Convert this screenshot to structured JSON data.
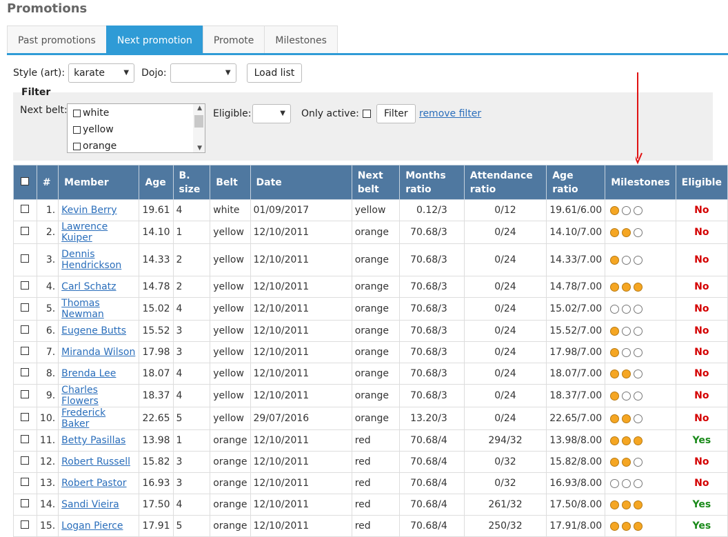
{
  "page": {
    "title": "Promotions"
  },
  "tabs": [
    {
      "label": "Past promotions",
      "active": false
    },
    {
      "label": "Next promotion",
      "active": true
    },
    {
      "label": "Promote",
      "active": false
    },
    {
      "label": "Milestones",
      "active": false
    }
  ],
  "toolbar": {
    "style_label": "Style (art):",
    "style_value": "karate",
    "dojo_label": "Dojo:",
    "dojo_value": "",
    "load_button": "Load list"
  },
  "filter": {
    "title": "Filter",
    "next_belt_label": "Next belt:",
    "belts": [
      "white",
      "yellow",
      "orange"
    ],
    "eligible_label": "Eligible:",
    "eligible_value": "",
    "only_active_label": "Only active:",
    "filter_button": "Filter",
    "remove_filter": "remove filter"
  },
  "table": {
    "headers": [
      "#",
      "Member",
      "Age",
      "B. size",
      "Belt",
      "Date",
      "Next belt",
      "Months ratio",
      "Attendance ratio",
      "Age ratio",
      "Milestones",
      "Eligible"
    ],
    "header_lines": {
      "bsize": [
        "B.",
        "size"
      ],
      "nextbelt": [
        "Next",
        "belt"
      ],
      "months": [
        "Months",
        "ratio"
      ],
      "attendance": [
        "Attendance",
        "ratio"
      ],
      "ageratio": [
        "Age",
        "ratio"
      ]
    },
    "rows": [
      {
        "n": "1.",
        "name": "Kevin Berry",
        "age": "19.61",
        "bsize": "4",
        "belt": "white",
        "date": "01/09/2017",
        "next": "yellow",
        "months": "0.12/3",
        "att": "0/12",
        "ageratio": "19.61/6.00",
        "milestones": [
          1,
          0,
          0
        ],
        "eligible": "No"
      },
      {
        "n": "2.",
        "name": "Lawrence Kuiper",
        "age": "14.10",
        "bsize": "1",
        "belt": "yellow",
        "date": "12/10/2011",
        "next": "orange",
        "months": "70.68/3",
        "att": "0/24",
        "ageratio": "14.10/7.00",
        "milestones": [
          1,
          1,
          0
        ],
        "eligible": "No"
      },
      {
        "n": "3.",
        "name": "Dennis Hendrickson",
        "age": "14.33",
        "bsize": "2",
        "belt": "yellow",
        "date": "12/10/2011",
        "next": "orange",
        "months": "70.68/3",
        "att": "0/24",
        "ageratio": "14.33/7.00",
        "milestones": [
          1,
          0,
          0
        ],
        "eligible": "No"
      },
      {
        "n": "4.",
        "name": "Carl Schatz",
        "age": "14.78",
        "bsize": "2",
        "belt": "yellow",
        "date": "12/10/2011",
        "next": "orange",
        "months": "70.68/3",
        "att": "0/24",
        "ageratio": "14.78/7.00",
        "milestones": [
          1,
          1,
          1
        ],
        "eligible": "No"
      },
      {
        "n": "5.",
        "name": "Thomas Newman",
        "age": "15.02",
        "bsize": "4",
        "belt": "yellow",
        "date": "12/10/2011",
        "next": "orange",
        "months": "70.68/3",
        "att": "0/24",
        "ageratio": "15.02/7.00",
        "milestones": [
          0,
          0,
          0
        ],
        "eligible": "No"
      },
      {
        "n": "6.",
        "name": "Eugene Butts",
        "age": "15.52",
        "bsize": "3",
        "belt": "yellow",
        "date": "12/10/2011",
        "next": "orange",
        "months": "70.68/3",
        "att": "0/24",
        "ageratio": "15.52/7.00",
        "milestones": [
          1,
          0,
          0
        ],
        "eligible": "No"
      },
      {
        "n": "7.",
        "name": "Miranda Wilson",
        "age": "17.98",
        "bsize": "3",
        "belt": "yellow",
        "date": "12/10/2011",
        "next": "orange",
        "months": "70.68/3",
        "att": "0/24",
        "ageratio": "17.98/7.00",
        "milestones": [
          1,
          0,
          0
        ],
        "eligible": "No"
      },
      {
        "n": "8.",
        "name": "Brenda Lee",
        "age": "18.07",
        "bsize": "4",
        "belt": "yellow",
        "date": "12/10/2011",
        "next": "orange",
        "months": "70.68/3",
        "att": "0/24",
        "ageratio": "18.07/7.00",
        "milestones": [
          1,
          1,
          0
        ],
        "eligible": "No"
      },
      {
        "n": "9.",
        "name": "Charles Flowers",
        "age": "18.37",
        "bsize": "4",
        "belt": "yellow",
        "date": "12/10/2011",
        "next": "orange",
        "months": "70.68/3",
        "att": "0/24",
        "ageratio": "18.37/7.00",
        "milestones": [
          1,
          0,
          0
        ],
        "eligible": "No"
      },
      {
        "n": "10.",
        "name": "Frederick Baker",
        "age": "22.65",
        "bsize": "5",
        "belt": "yellow",
        "date": "29/07/2016",
        "next": "orange",
        "months": "13.20/3",
        "att": "0/24",
        "ageratio": "22.65/7.00",
        "milestones": [
          1,
          1,
          0
        ],
        "eligible": "No"
      },
      {
        "n": "11.",
        "name": "Betty Pasillas",
        "age": "13.98",
        "bsize": "1",
        "belt": "orange",
        "date": "12/10/2011",
        "next": "red",
        "months": "70.68/4",
        "att": "294/32",
        "ageratio": "13.98/8.00",
        "milestones": [
          1,
          1,
          1
        ],
        "eligible": "Yes"
      },
      {
        "n": "12.",
        "name": "Robert Russell",
        "age": "15.82",
        "bsize": "3",
        "belt": "orange",
        "date": "12/10/2011",
        "next": "red",
        "months": "70.68/4",
        "att": "0/32",
        "ageratio": "15.82/8.00",
        "milestones": [
          1,
          1,
          0
        ],
        "eligible": "No"
      },
      {
        "n": "13.",
        "name": "Robert Pastor",
        "age": "16.93",
        "bsize": "3",
        "belt": "orange",
        "date": "12/10/2011",
        "next": "red",
        "months": "70.68/4",
        "att": "0/32",
        "ageratio": "16.93/8.00",
        "milestones": [
          0,
          0,
          0
        ],
        "eligible": "No"
      },
      {
        "n": "14.",
        "name": "Sandi Vieira",
        "age": "17.50",
        "bsize": "4",
        "belt": "orange",
        "date": "12/10/2011",
        "next": "red",
        "months": "70.68/4",
        "att": "261/32",
        "ageratio": "17.50/8.00",
        "milestones": [
          1,
          1,
          1
        ],
        "eligible": "Yes"
      },
      {
        "n": "15.",
        "name": "Logan Pierce",
        "age": "17.91",
        "bsize": "5",
        "belt": "orange",
        "date": "12/10/2011",
        "next": "red",
        "months": "70.68/4",
        "att": "250/32",
        "ageratio": "17.91/8.00",
        "milestones": [
          1,
          1,
          1
        ],
        "eligible": "Yes"
      }
    ]
  },
  "colors": {
    "accent": "#2f9bd6",
    "header_bg": "#4f78a0",
    "milestone_on": "#f5a623",
    "yes": "#1a8a1a",
    "no": "#d40000",
    "arrow": "#e01010"
  },
  "icons": {
    "arrow": "red-down-arrow-icon"
  }
}
